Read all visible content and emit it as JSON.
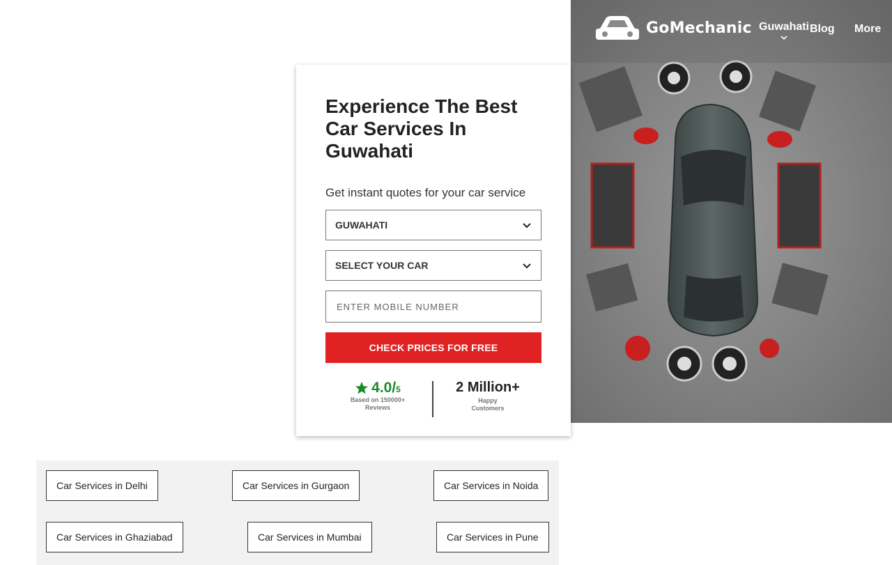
{
  "header": {
    "brand": "GoMechanic",
    "nav": {
      "city": "Guwahati",
      "blog": "Blog",
      "more": "More"
    }
  },
  "hero": {
    "title": "Experience The Best Car Services In Guwahati",
    "subtitle": "Get instant quotes for your car service",
    "form": {
      "city_value": "GUWAHATI",
      "car_value": "SELECT YOUR CAR",
      "mobile_placeholder": "ENTER MOBILE NUMBER",
      "cta_label": "CHECK PRICES FOR FREE"
    },
    "stats": {
      "rating": "4.0/",
      "rating_max": "5",
      "rating_note": "Based on 150000+ Reviews",
      "customers": "2 Million+",
      "customers_note": "Happy Customers"
    }
  },
  "city_links": [
    "Car Services in Delhi",
    "Car Services in Gurgaon",
    "Car Services in Noida",
    "Car Services in Ghaziabad",
    "Car Services in Mumbai",
    "Car Services in Pune"
  ],
  "colors": {
    "accent": "#e02222",
    "rating": "#1a8a2a",
    "panel": "#f2f2f2"
  }
}
